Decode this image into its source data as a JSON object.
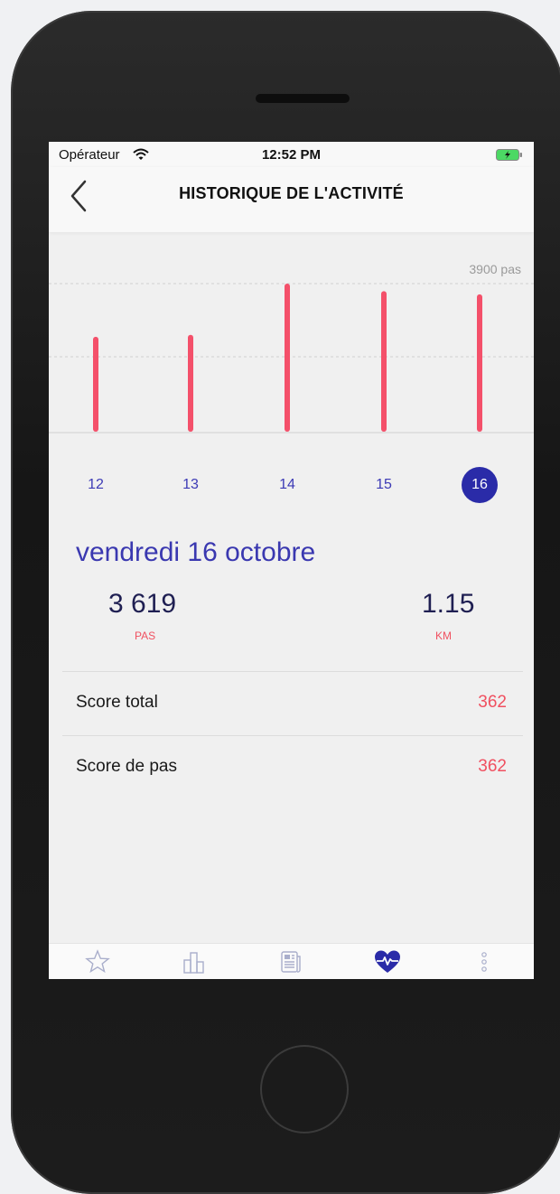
{
  "status_bar": {
    "carrier": "Opérateur",
    "time": "12:52 PM"
  },
  "header": {
    "title": "HISTORIQUE DE L'ACTIVITÉ",
    "back_icon": "chevron-left-icon"
  },
  "chart_data": {
    "type": "bar",
    "categories": [
      "12",
      "13",
      "14",
      "15",
      "16"
    ],
    "values": [
      2500,
      2550,
      3900,
      3700,
      3619
    ],
    "reference_label": "3900 pas",
    "ylim": [
      0,
      3900
    ],
    "grid": "dashed",
    "color": "#f4506a",
    "selected_index": 4
  },
  "days": [
    {
      "label": "12",
      "selected": false
    },
    {
      "label": "13",
      "selected": false
    },
    {
      "label": "14",
      "selected": false
    },
    {
      "label": "15",
      "selected": false
    },
    {
      "label": "16",
      "selected": true
    }
  ],
  "detail": {
    "date": "vendredi 16 octobre",
    "steps_value": "3 619",
    "steps_unit": "PAS",
    "distance_value": "1.15",
    "distance_unit": "KM"
  },
  "scores": [
    {
      "label": "Score total",
      "value": "362"
    },
    {
      "label": "Score de pas",
      "value": "362"
    }
  ],
  "tabbar": {
    "items": [
      {
        "icon": "star-icon",
        "active": false
      },
      {
        "icon": "bar-chart-icon",
        "active": false
      },
      {
        "icon": "news-icon",
        "active": false
      },
      {
        "icon": "heart-pulse-icon",
        "active": true
      },
      {
        "icon": "more-vertical-icon",
        "active": false
      }
    ]
  },
  "colors": {
    "accent": "#2a2ba8",
    "bar": "#f4506a",
    "score": "#f05060"
  }
}
